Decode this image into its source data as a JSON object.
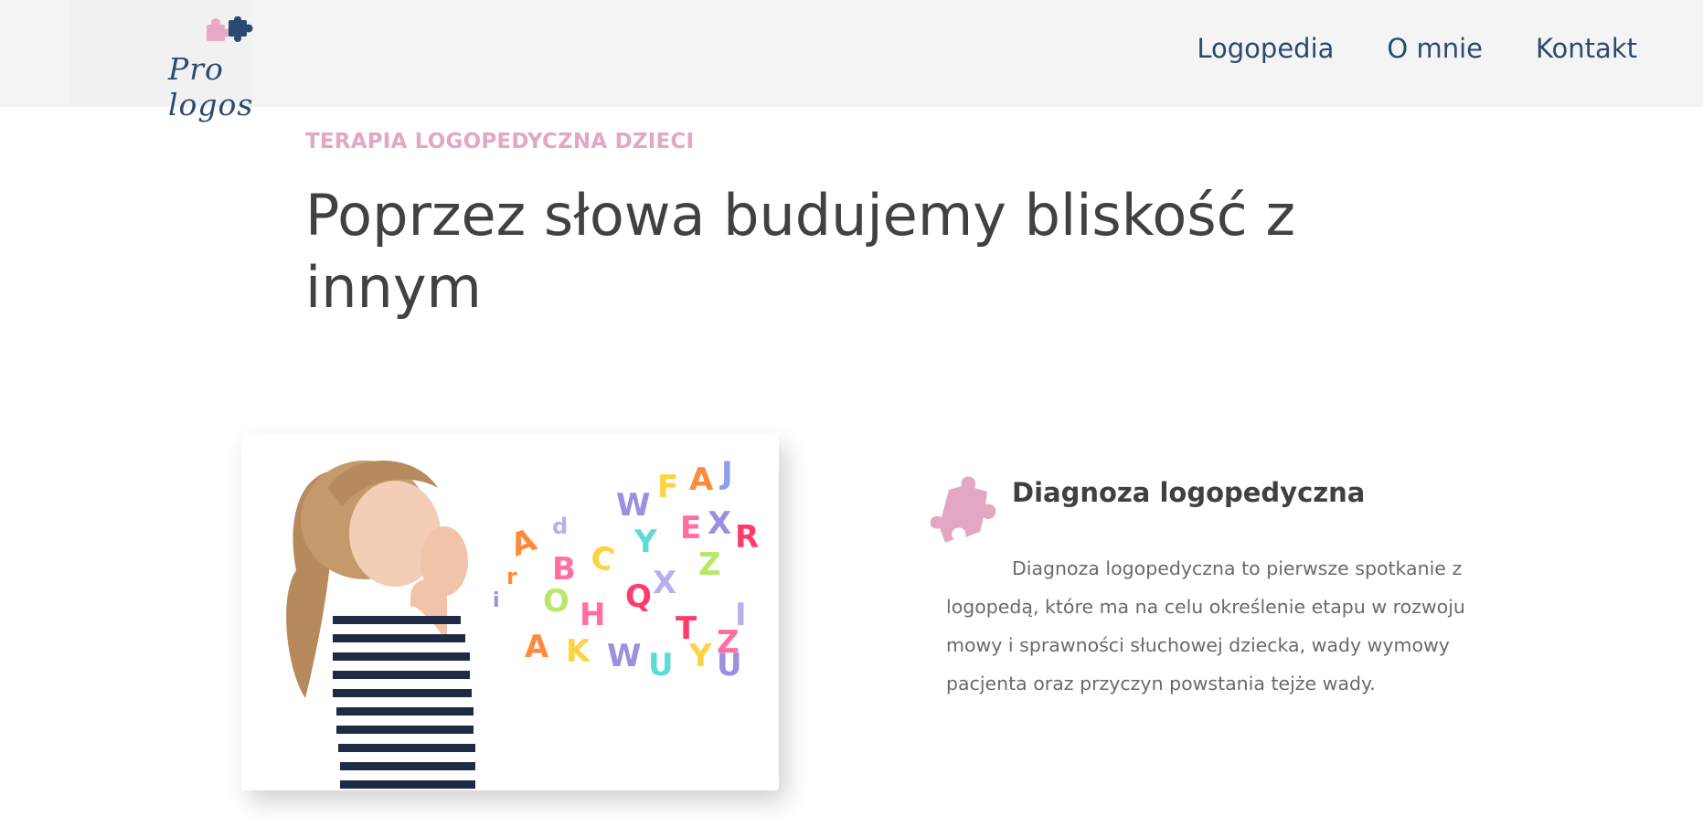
{
  "header": {
    "logo_text": "Pro logos",
    "nav": [
      {
        "label": "Logopedia"
      },
      {
        "label": "O mnie"
      },
      {
        "label": "Kontakt"
      }
    ]
  },
  "hero": {
    "eyebrow": "TERAPIA LOGOPEDYCZNA DZIECI",
    "headline": "Poprzez słowa budujemy bliskość z innym"
  },
  "service": {
    "icon": "puzzle-piece-icon",
    "title": "Diagnoza logopedyczna",
    "description": "Diagnoza logopedyczna to pierwsze spotkanie z logopedą, które ma na celu określenie etapu w rozwoju mowy i sprawności słuchowej dziecka, wady wymowy pacjenta oraz przyczyn powstania tejże wady."
  },
  "colors": {
    "brand_navy": "#2b4a72",
    "brand_pink": "#e3a7c3",
    "heading": "#414141",
    "body_text": "#6a6a6a",
    "header_bg": "#f4f4f4"
  }
}
